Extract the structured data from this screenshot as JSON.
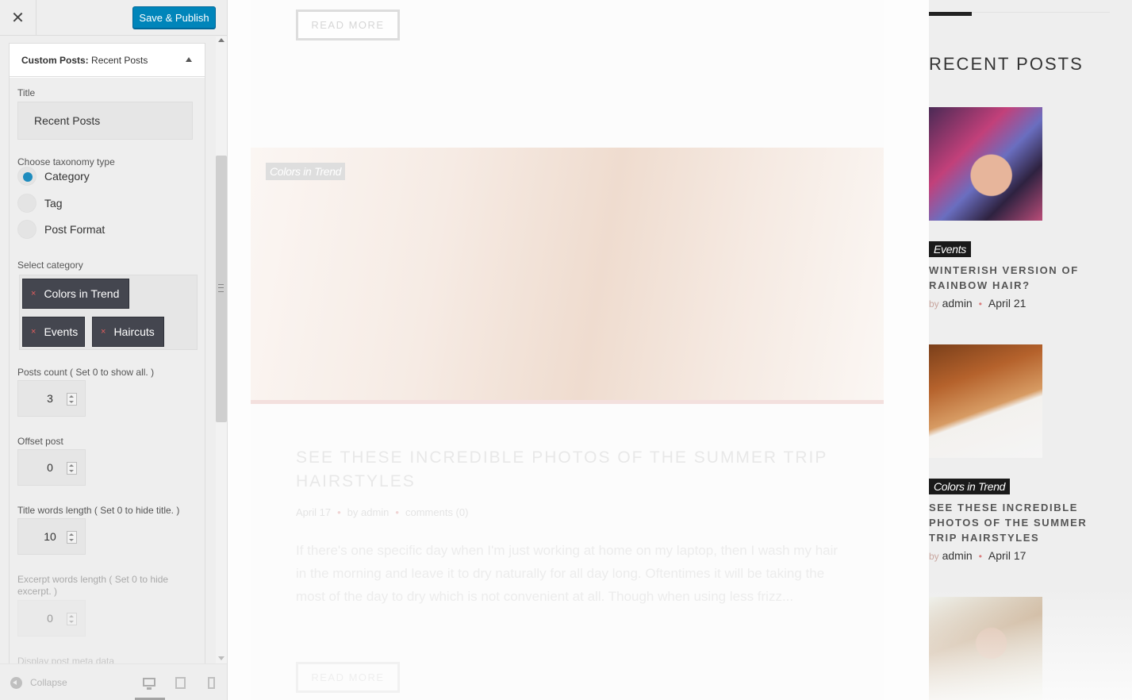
{
  "customizer": {
    "close_glyph": "✕",
    "save_label": "Save & Publish",
    "section": {
      "title_bold": "Custom Posts:",
      "title_rest": " Recent Posts"
    },
    "fields": {
      "title_label": "Title",
      "title_value": "Recent Posts",
      "taxonomy_label": "Choose taxonomy type",
      "taxonomy_options": [
        {
          "label": "Category",
          "checked": true
        },
        {
          "label": "Tag",
          "checked": false
        },
        {
          "label": "Post Format",
          "checked": false
        }
      ],
      "category_label": "Select category",
      "categories": [
        "Colors in Trend",
        "Events",
        "Haircuts"
      ],
      "remove_glyph": "×",
      "posts_count_label": "Posts count ( Set 0 to show all. )",
      "posts_count_value": "3",
      "offset_label": "Offset post",
      "offset_value": "0",
      "title_words_label": "Title words length ( Set 0 to hide title. )",
      "title_words_value": "10",
      "excerpt_words_label": "Excerpt words length ( Set 0 to hide excerpt. )",
      "excerpt_words_value": "0",
      "display_meta_label": "Display post meta data"
    },
    "footer": {
      "collapse_label": "Collapse"
    }
  },
  "preview": {
    "read_more_label": "READ MORE",
    "post": {
      "category": "Colors in Trend",
      "title": "SEE THESE INCREDIBLE PHOTOS OF THE SUMMER TRIP HAIRSTYLES",
      "date": "April 17",
      "by": "by",
      "author": "admin",
      "comments": "comments (0)",
      "excerpt": "If there's one specific day when I'm just working at home on my laptop, then I wash my hair in the morning and leave it to dry naturally for all day long. Oftentimes it will be taking the most of the day to dry which is not convenient at all. Though when using less frizz..."
    },
    "sidebar": {
      "title": "RECENT POSTS",
      "posts": [
        {
          "category": "Events",
          "title": "WINTERISH VERSION OF RAINBOW HAIR?",
          "by": "by",
          "author": "admin",
          "date": "April 21"
        },
        {
          "category": "Colors in Trend",
          "title": "SEE THESE INCREDIBLE PHOTOS OF THE SUMMER TRIP HAIRSTYLES",
          "by": "by",
          "author": "admin",
          "date": "April 17"
        }
      ]
    }
  },
  "colors": {
    "accent": "#0085ba",
    "radio_checked": "#1e8cbe",
    "chip_bg": "#44464f",
    "chip_remove": "#e35d5d",
    "sidebar_category_bg": "#1a1a1a"
  }
}
